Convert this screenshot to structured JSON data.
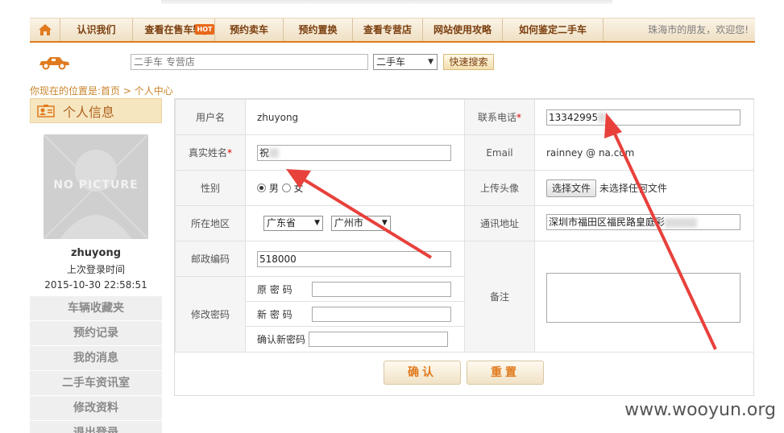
{
  "nav": {
    "items": [
      "认识我们",
      "查看在售车辆",
      "预约卖车",
      "预约置换",
      "查看专营店",
      "网站使用攻略",
      "如何鉴定二手车"
    ],
    "hot_badge": "HOT",
    "greeting": "珠海市的朋友，欢迎您!"
  },
  "search": {
    "placeholder": "二手车 专营店",
    "select_value": "二手车",
    "button_label": "快速搜索"
  },
  "breadcrumb": "你现在的位置是:首页 > 个人中心",
  "sidebar": {
    "title": "个人信息",
    "no_picture": "NO PICTURE",
    "username": "zhuyong",
    "last_login_label": "上次登录时间",
    "last_login_time": "2015-10-30 22:58:51",
    "menu": [
      "车辆收藏夹",
      "预约记录",
      "我的消息",
      "二手车资讯室",
      "修改资料",
      "退出登录"
    ]
  },
  "form": {
    "username_label": "用户名",
    "username_value": "zhuyong",
    "phone_label": "联系电话",
    "phone_value": "13342995",
    "realname_label": "真实姓名",
    "realname_value": "祝",
    "email_label": "Email",
    "email_value": "rainney   @   na.com",
    "gender_label": "性别",
    "gender_male": "男",
    "gender_female": "女",
    "avatar_label": "上传头像",
    "file_button": "选择文件",
    "file_status": "未选择任何文件",
    "region_label": "所在地区",
    "province": "广东省",
    "city": "广州市",
    "address_label": "通讯地址",
    "address_value": "深圳市福田区福民路皇庭彩",
    "zipcode_label": "邮政编码",
    "zipcode_value": "518000",
    "password_label": "修改密码",
    "old_pw_label": "原 密 码",
    "new_pw_label": "新 密 码",
    "confirm_pw_label": "确认新密码",
    "remark_label": "备注",
    "required_mark": "*"
  },
  "buttons": {
    "confirm": "确认",
    "reset": "重置"
  },
  "watermark": "www.wooyun.org",
  "colors": {
    "accent": "#e07a1e",
    "arrow": "#e8413c",
    "nav_text": "#7a3e0e"
  }
}
